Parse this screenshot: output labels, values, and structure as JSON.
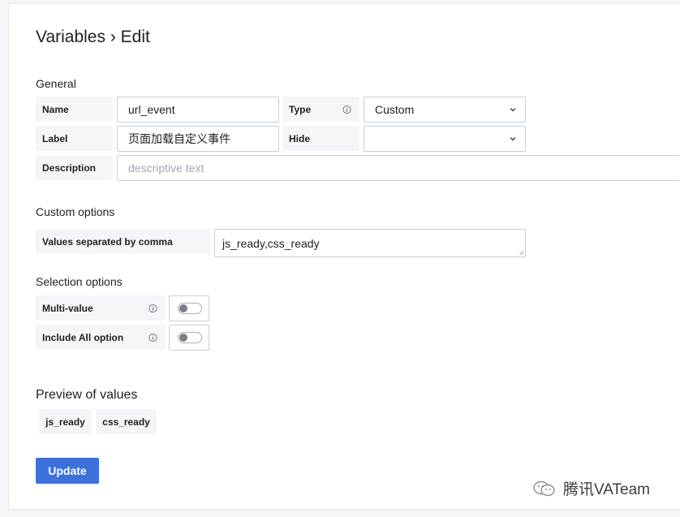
{
  "page": {
    "title": "Variables › Edit"
  },
  "general": {
    "title": "General",
    "name_label": "Name",
    "name_value": "url_event",
    "type_label": "Type",
    "type_value": "Custom",
    "label_label": "Label",
    "label_value": "页面加载自定义事件",
    "hide_label": "Hide",
    "hide_value": "",
    "description_label": "Description",
    "description_placeholder": "descriptive text"
  },
  "custom_options": {
    "title": "Custom options",
    "values_label": "Values separated by comma",
    "values_value": "js_ready,css_ready"
  },
  "selection_options": {
    "title": "Selection options",
    "multi_value_label": "Multi-value",
    "multi_value_enabled": false,
    "include_all_label": "Include All option",
    "include_all_enabled": false
  },
  "preview": {
    "title": "Preview of values",
    "values": [
      "js_ready",
      "css_ready"
    ]
  },
  "actions": {
    "update_label": "Update"
  },
  "watermark": {
    "text": "腾讯VATeam"
  },
  "colors": {
    "primary": "#3d71d9",
    "label_bg": "#f4f5f8",
    "border": "#c7d0d9"
  }
}
